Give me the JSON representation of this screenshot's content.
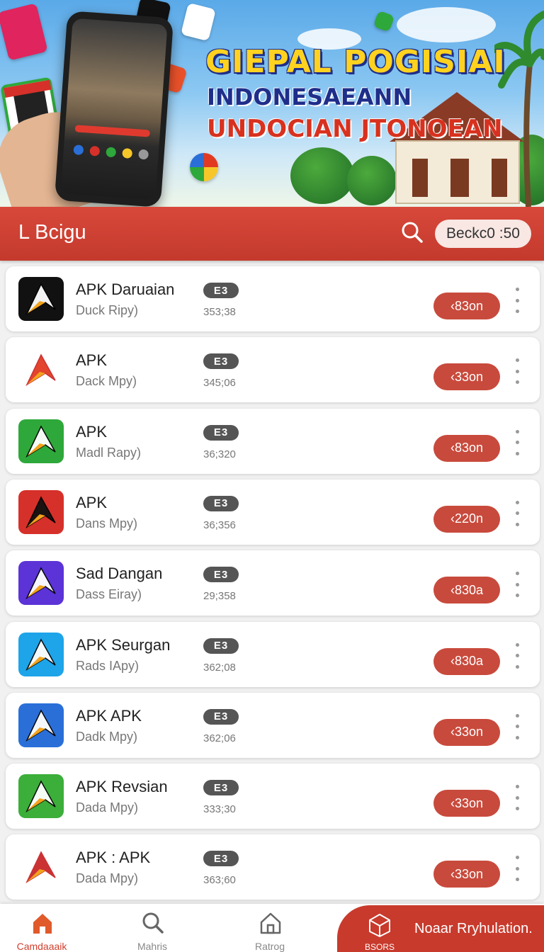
{
  "banner": {
    "title_line1": "GIEPAL POGISIAI",
    "title_line2": "INDONESAEANN",
    "title_line3": "UNDOCIAN JTONOEAN"
  },
  "header": {
    "title": "L Bcigu",
    "search_icon": "search-icon",
    "pill_label": "Beckc0 :50"
  },
  "apps": [
    {
      "name": "APK Daruaian",
      "subtitle": "Duck Ripy)",
      "badge": "E3",
      "stat": "353;38",
      "action": "‹83on",
      "icon_bg": "#111111",
      "icon_accent": "#ffffff"
    },
    {
      "name": "APK",
      "subtitle": "Dack Mpy)",
      "badge": "E3",
      "stat": "345;06",
      "action": "‹33on",
      "icon_bg": "#ffffff",
      "icon_accent": "#e23a22"
    },
    {
      "name": "APK",
      "subtitle": "Madl Rapy)",
      "badge": "E3",
      "stat": "36;320",
      "action": "‹83on",
      "icon_bg": "#2ea83a",
      "icon_accent": "#ffffff"
    },
    {
      "name": "APK",
      "subtitle": "Dans Mpy)",
      "badge": "E3",
      "stat": "36;356",
      "action": "‹220n",
      "icon_bg": "#d6302a",
      "icon_accent": "#111111"
    },
    {
      "name": "Sad Dangan",
      "subtitle": "Dass Eiray)",
      "badge": "E3",
      "stat": "29;358",
      "action": "‹830a",
      "icon_bg": "#5b33d6",
      "icon_accent": "#ffffff"
    },
    {
      "name": "APK Seurgan",
      "subtitle": "Rads IApy)",
      "badge": "E3",
      "stat": "362;08",
      "action": "‹830a",
      "icon_bg": "#1ea4e8",
      "icon_accent": "#ffffff"
    },
    {
      "name": "APK APK",
      "subtitle": "Dadk Mpy)",
      "badge": "E3",
      "stat": "362;06",
      "action": "‹33on",
      "icon_bg": "#2a6fd8",
      "icon_accent": "#ffffff"
    },
    {
      "name": "APK Revsian",
      "subtitle": "Dada Mpy)",
      "badge": "E3",
      "stat": "333;30",
      "action": "‹33on",
      "icon_bg": "#3cae3a",
      "icon_accent": "#ffffff"
    },
    {
      "name": "APK : APK",
      "subtitle": "Dada Mpy)",
      "badge": "E3",
      "stat": "363;60",
      "action": "‹33on",
      "icon_bg": "#ffffff",
      "icon_accent": "#c8282a"
    }
  ],
  "nav": {
    "items": [
      {
        "label": "Camdaaaik",
        "icon": "home-icon",
        "active": true
      },
      {
        "label": "Mahris",
        "icon": "search-icon",
        "active": false
      },
      {
        "label": "Ratrog",
        "icon": "house-outline-icon",
        "active": false
      }
    ],
    "promo": {
      "item_label": "BSORS",
      "icon": "box-icon",
      "text": "Noaar Rryhulation."
    }
  },
  "colors": {
    "accent": "#c83a2c",
    "header_gradient_top": "#d8483a",
    "badge": "#555555",
    "action": "#c84a3c"
  }
}
